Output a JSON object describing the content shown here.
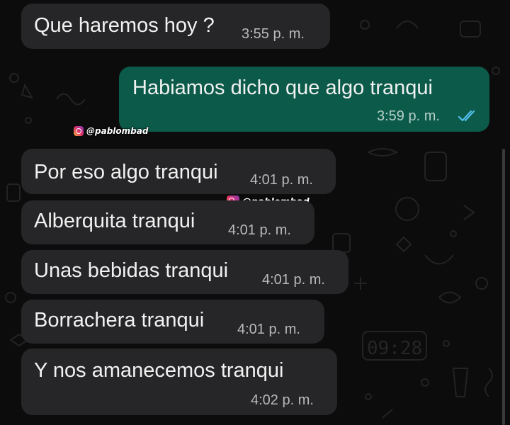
{
  "messages": [
    {
      "direction": "incoming",
      "text": "Que haremos hoy ?",
      "time": "3:55 p. m."
    },
    {
      "direction": "outgoing",
      "text": "Habiamos dicho que algo tranqui",
      "time": "3:59 p. m.",
      "status": "read-double-check"
    },
    {
      "direction": "incoming",
      "text": "Por eso algo tranqui",
      "time": "4:01 p. m."
    },
    {
      "direction": "incoming",
      "text": "Alberquita tranqui",
      "time": "4:01 p. m."
    },
    {
      "direction": "incoming",
      "text": "Unas bebidas tranqui",
      "time": "4:01 p. m."
    },
    {
      "direction": "incoming",
      "text": "Borrachera tranqui",
      "time": "4:01 p. m."
    },
    {
      "direction": "incoming",
      "text": "Y nos amanecemos tranqui",
      "time": "4:02 p. m."
    }
  ],
  "watermarks": [
    {
      "handle": "@pablombad",
      "icon": "instagram-icon"
    },
    {
      "handle": "@pablombad",
      "icon": "instagram-icon"
    }
  ],
  "colors": {
    "background": "#0c0c0c",
    "incoming_bubble": "#262628",
    "outgoing_bubble": "#0c5b4a",
    "read_ticks": "#53bdeb"
  }
}
